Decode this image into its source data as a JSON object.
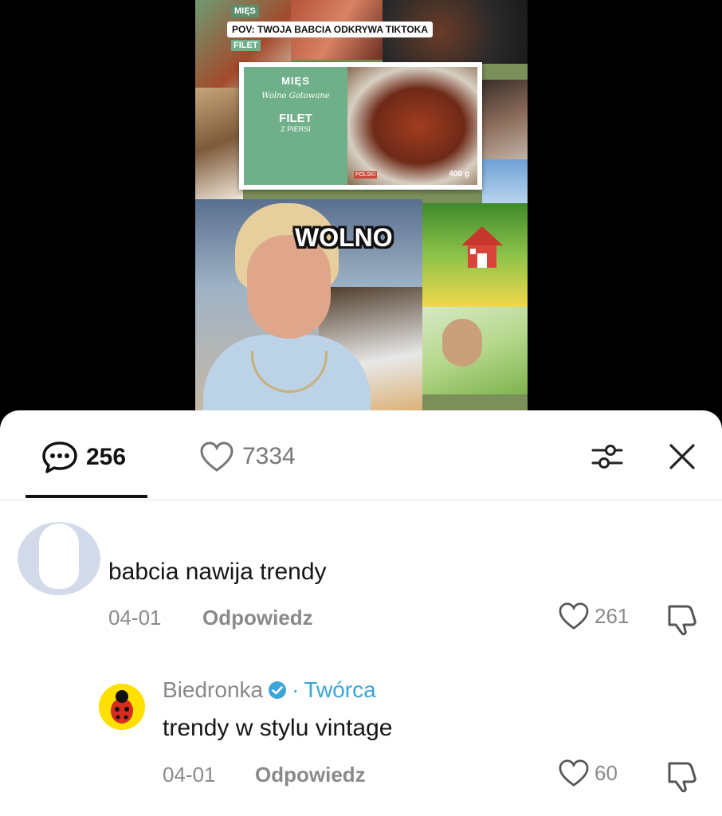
{
  "video": {
    "banner": "POV: TWOJA BABCIA ODKRYWA TIKTOKA",
    "logo_top": "MIĘS",
    "label_left": "FILET",
    "pack_brand": "MIĘS",
    "pack_sub": "Wolno Gotowane",
    "pack_product": "FILET",
    "pack_product2": "Z PIERSI",
    "pack_weight": "400 g",
    "pack_origin": "POLSKI",
    "overlay_text": "WOLNO"
  },
  "tabs": {
    "comments_count": "256",
    "likes_count": "7334"
  },
  "comments": [
    {
      "text": "babcia nawija trendy",
      "date": "04-01",
      "reply_label": "Odpowiedz",
      "likes": "261"
    },
    {
      "author": "Biedronka",
      "separator": "·",
      "badge": "Twórca",
      "text": "trendy w stylu vintage",
      "date": "04-01",
      "reply_label": "Odpowiedz",
      "likes": "60"
    }
  ],
  "icons": {
    "comments_tab": "comment-bubble-icon",
    "likes_tab": "heart-icon",
    "filter": "sliders-icon",
    "close": "close-icon",
    "like": "heart-icon",
    "dislike": "thumbs-down-icon",
    "verified": "verified-badge-icon"
  },
  "colors": {
    "accent_creator": "#3aa5d8",
    "muted_text": "#8a8a8a",
    "sheet_bg": "#ffffff"
  }
}
